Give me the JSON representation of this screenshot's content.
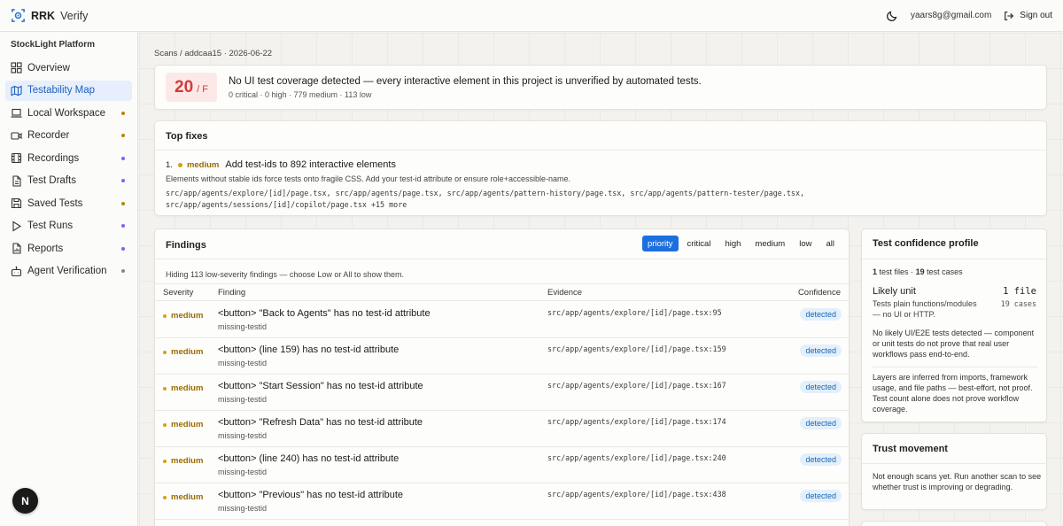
{
  "app": {
    "brand_bold": "RRK",
    "brand_light": "Verify"
  },
  "header": {
    "email": "yaars8g@gmail.com",
    "signout_label": "Sign out"
  },
  "sidebar": {
    "section": "StockLight Platform",
    "items": [
      {
        "label": "Overview",
        "icon": "grid-icon",
        "dot": null
      },
      {
        "label": "Testability Map",
        "icon": "map-icon",
        "dot": null,
        "active": true
      },
      {
        "label": "Local Workspace",
        "icon": "laptop-icon",
        "dot": "#b8860b"
      },
      {
        "label": "Recorder",
        "icon": "video-icon",
        "dot": "#b8860b"
      },
      {
        "label": "Recordings",
        "icon": "film-icon",
        "dot": "#8b5cf6"
      },
      {
        "label": "Test Drafts",
        "icon": "file-icon",
        "dot": "#8b5cf6"
      },
      {
        "label": "Saved Tests",
        "icon": "save-icon",
        "dot": "#b8860b"
      },
      {
        "label": "Test Runs",
        "icon": "play-icon",
        "dot": "#8b5cf6"
      },
      {
        "label": "Reports",
        "icon": "report-icon",
        "dot": "#8b5cf6"
      },
      {
        "label": "Agent Verification",
        "icon": "bot-icon",
        "dot": "#888888"
      }
    ]
  },
  "breadcrumb": "Scans / addcaa15 · 2026-06-22",
  "score": {
    "value": "20",
    "grade": "/ F",
    "title": "No UI test coverage detected — every interactive element in this project is unverified by automated tests.",
    "summary": "0 critical · 0 high · 779 medium · 113 low"
  },
  "top_fixes": {
    "title": "Top fixes",
    "items": [
      {
        "index": "1.",
        "severity": "medium",
        "title": "Add test-ids to 892 interactive elements",
        "description": "Elements without stable ids force tests onto fragile CSS. Add your test-id attribute or ensure role+accessible-name.",
        "files_line1": "src/app/agents/explore/[id]/page.tsx, src/app/agents/page.tsx, src/app/agents/pattern-history/page.tsx, src/app/agents/pattern-tester/page.tsx,",
        "files_line2": "src/app/agents/sessions/[id]/copilot/page.tsx +15 more"
      }
    ]
  },
  "findings": {
    "title": "Findings",
    "filters": [
      "priority",
      "critical",
      "high",
      "medium",
      "low",
      "all"
    ],
    "active_filter": "priority",
    "hiding_note": "Hiding 113 low-severity findings — choose Low or All to show them.",
    "columns": [
      "Severity",
      "Finding",
      "Evidence",
      "Confidence"
    ],
    "rows": [
      {
        "severity": "medium",
        "title": "<button> \"Back to Agents\" has no test-id attribute",
        "rule": "missing-testid",
        "evidence": "src/app/agents/explore/[id]/page.tsx:95",
        "confidence": "detected"
      },
      {
        "severity": "medium",
        "title": "<button> (line 159) has no test-id attribute",
        "rule": "missing-testid",
        "evidence": "src/app/agents/explore/[id]/page.tsx:159",
        "confidence": "detected"
      },
      {
        "severity": "medium",
        "title": "<button> \"Start Session\" has no test-id attribute",
        "rule": "missing-testid",
        "evidence": "src/app/agents/explore/[id]/page.tsx:167",
        "confidence": "detected"
      },
      {
        "severity": "medium",
        "title": "<button> \"Refresh Data\" has no test-id attribute",
        "rule": "missing-testid",
        "evidence": "src/app/agents/explore/[id]/page.tsx:174",
        "confidence": "detected"
      },
      {
        "severity": "medium",
        "title": "<button> (line 240) has no test-id attribute",
        "rule": "missing-testid",
        "evidence": "src/app/agents/explore/[id]/page.tsx:240",
        "confidence": "detected"
      },
      {
        "severity": "medium",
        "title": "<button> \"Previous\" has no test-id attribute",
        "rule": "missing-testid",
        "evidence": "src/app/agents/explore/[id]/page.tsx:438",
        "confidence": "detected"
      }
    ]
  },
  "confidence_profile": {
    "title": "Test confidence profile",
    "test_files": "1",
    "test_files_label": "test files ·",
    "test_cases": "19",
    "test_cases_label": "test cases",
    "layer": {
      "name": "Likely unit",
      "description": "Tests plain functions/modules — no UI or HTTP.",
      "files": "1 file",
      "cases": "19 cases"
    },
    "note": "No likely UI/E2E tests detected — component or unit tests do not prove that real user workflows pass end-to-end.",
    "footer": "Layers are inferred from imports, framework usage, and file paths — best-effort, not proof. Test count alone does not prove workflow coverage."
  },
  "trust_movement": {
    "title": "Trust movement",
    "text": "Not enough scans yet. Run another scan to see whether trust is improving or degrading."
  },
  "dev_badge": "N"
}
